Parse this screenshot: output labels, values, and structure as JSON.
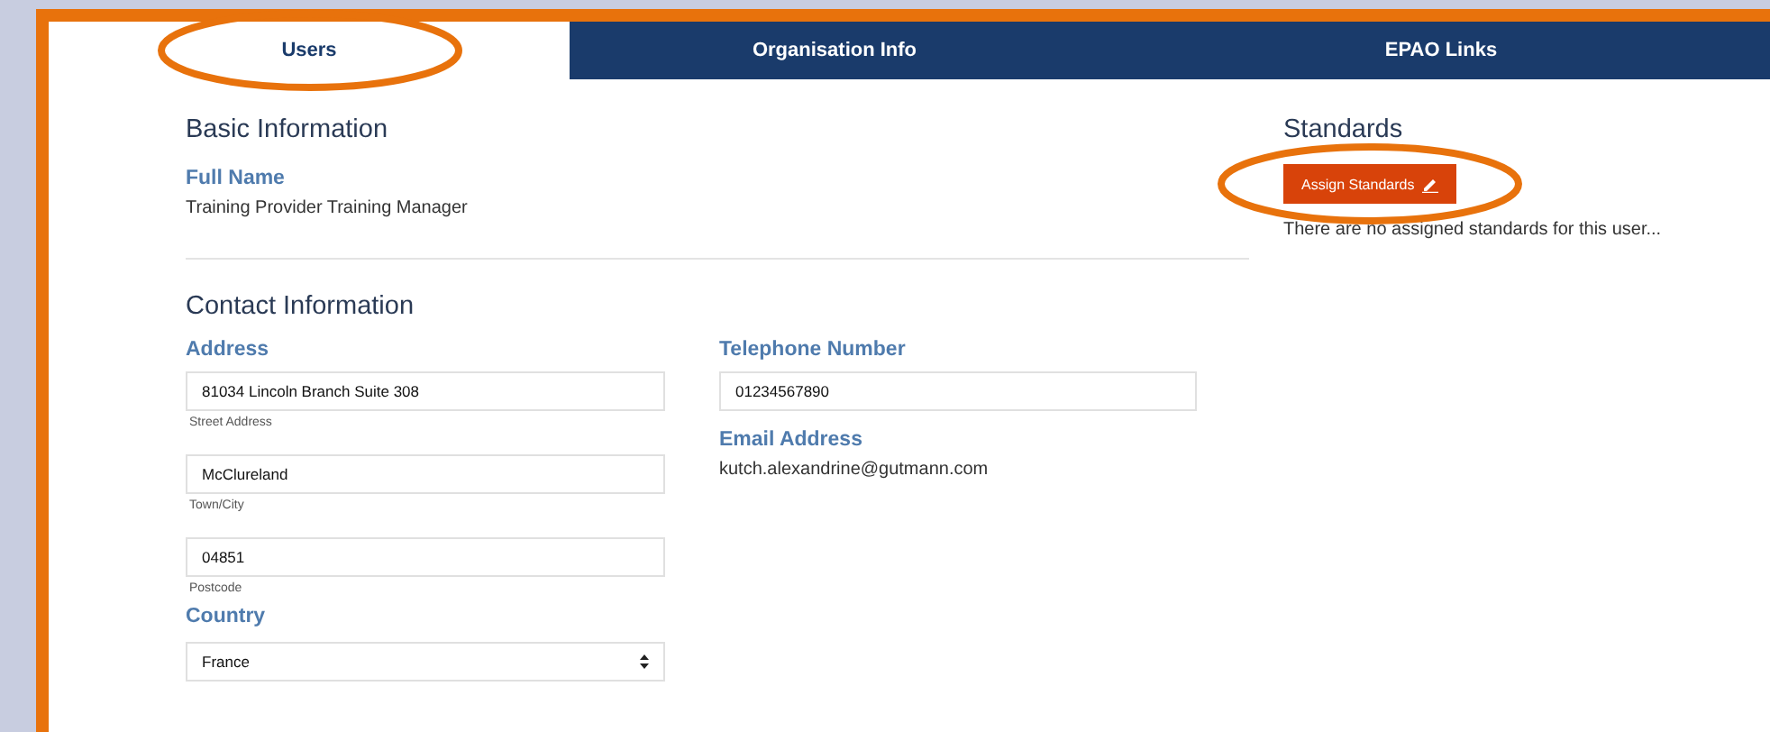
{
  "tabs": [
    {
      "label": "Users",
      "selected": true,
      "highlighted": true
    },
    {
      "label": "Organisation Info",
      "selected": false,
      "highlighted": false
    },
    {
      "label": "EPAO Links",
      "selected": false,
      "highlighted": false
    }
  ],
  "basic_information": {
    "heading": "Basic Information",
    "full_name_label": "Full Name",
    "full_name": "Training Provider Training Manager"
  },
  "contact_information": {
    "heading": "Contact Information",
    "address_label": "Address",
    "address_fields": [
      {
        "value": "81034 Lincoln Branch Suite 308",
        "hint": "Street Address"
      },
      {
        "value": "McClureland",
        "hint": "Town/City"
      },
      {
        "value": "04851",
        "hint": "Postcode"
      }
    ],
    "country_label": "Country",
    "country": "France",
    "telephone_label": "Telephone Number",
    "telephone": "01234567890",
    "email_label": "Email Address",
    "email": "kutch.alexandrine@gutmann.com"
  },
  "standards": {
    "heading": "Standards",
    "button": "Assign Standards",
    "button_highlighted": true,
    "empty_message": "There are no assigned standards for this user..."
  }
}
